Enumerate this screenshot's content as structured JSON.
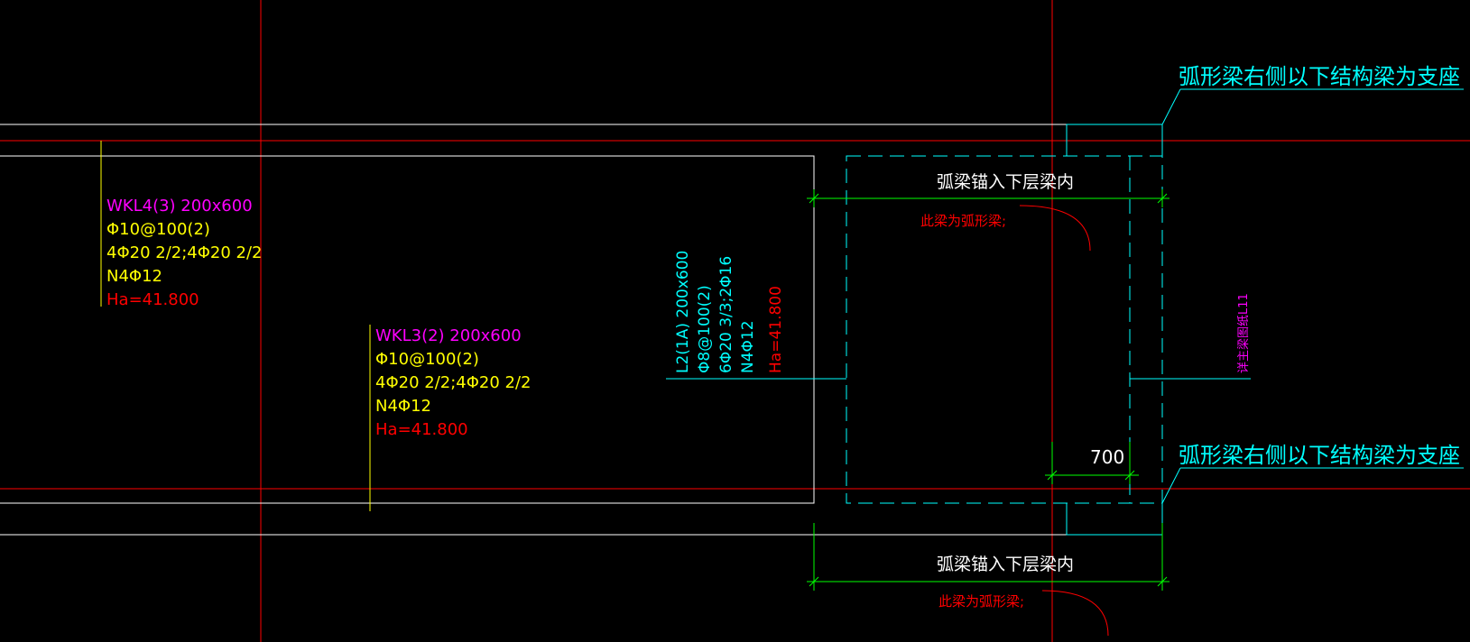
{
  "colors": {
    "background": "#000000",
    "white": "#ffffff",
    "red": "#ff0000",
    "yellow": "#ffff00",
    "magenta": "#ff00ff",
    "cyan": "#00ffff",
    "green": "#00ff00"
  },
  "beams": {
    "wkl4": {
      "name": "WKL4(3) 200x600",
      "stirrup": "Φ10@100(2)",
      "rebar": "4Φ20 2/2;4Φ20 2/2",
      "waist": "N4Φ12",
      "elevation": "Ha=41.800"
    },
    "wkl3": {
      "name": "WKL3(2) 200x600",
      "stirrup": "Φ10@100(2)",
      "rebar": "4Φ20 2/2;4Φ20 2/2",
      "waist": "N4Φ12",
      "elevation": "Ha=41.800"
    },
    "l2": {
      "name": "L2(1A) 200x600",
      "stirrup": "Φ8@100(2)",
      "rebar": "6Φ20 3/3;2Φ16",
      "waist": "N4Φ12",
      "elevation": "Ha=41.800"
    }
  },
  "notes": {
    "support_top": "弧形梁右侧以下结构梁为支座",
    "support_bottom": "弧形梁右侧以下结构梁为支座",
    "anchor_top": "弧梁锚入下层梁内",
    "anchor_bottom": "弧梁锚入下层梁内",
    "curved_top": "此梁为弧形梁;",
    "curved_bottom": "此梁为弧形梁;",
    "vertical_note": "详主梁图纸L11",
    "dimension": "700"
  }
}
